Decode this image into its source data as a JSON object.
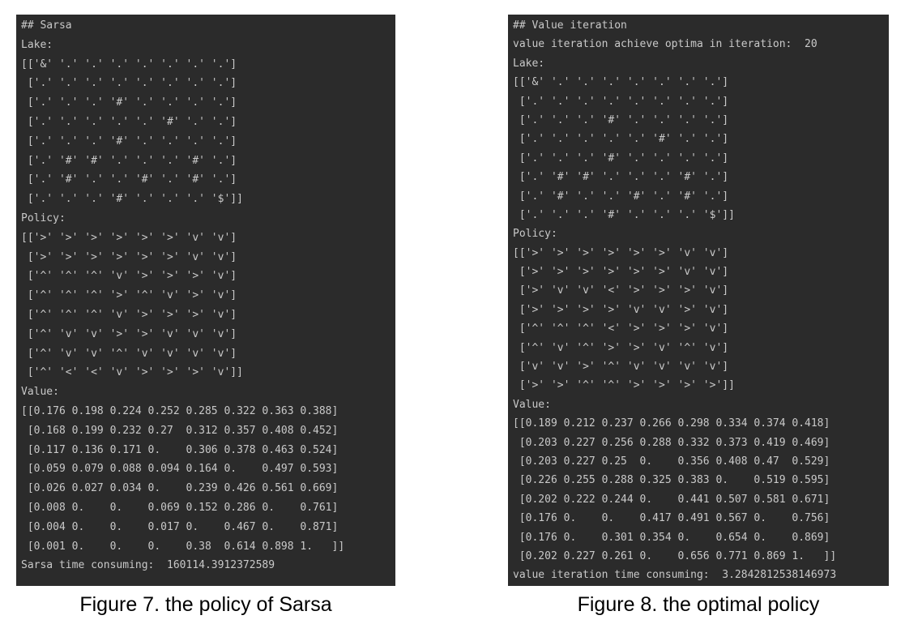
{
  "left": {
    "lines": [
      "## Sarsa",
      "Lake:",
      "[['&' '.' '.' '.' '.' '.' '.' '.']",
      " ['.' '.' '.' '.' '.' '.' '.' '.']",
      " ['.' '.' '.' '#' '.' '.' '.' '.']",
      " ['.' '.' '.' '.' '.' '#' '.' '.']",
      " ['.' '.' '.' '#' '.' '.' '.' '.']",
      " ['.' '#' '#' '.' '.' '.' '#' '.']",
      " ['.' '#' '.' '.' '#' '.' '#' '.']",
      " ['.' '.' '.' '#' '.' '.' '.' '$']]",
      "Policy:",
      "[['>' '>' '>' '>' '>' '>' 'v' 'v']",
      " ['>' '>' '>' '>' '>' '>' 'v' 'v']",
      " ['^' '^' '^' 'v' '>' '>' '>' 'v']",
      " ['^' '^' '^' '>' '^' 'v' '>' 'v']",
      " ['^' '^' '^' 'v' '>' '>' '>' 'v']",
      " ['^' 'v' 'v' '>' '>' 'v' 'v' 'v']",
      " ['^' 'v' 'v' '^' 'v' 'v' 'v' 'v']",
      " ['^' '<' '<' 'v' '>' '>' '>' 'v']]",
      "Value:",
      "[[0.176 0.198 0.224 0.252 0.285 0.322 0.363 0.388]",
      " [0.168 0.199 0.232 0.27  0.312 0.357 0.408 0.452]",
      " [0.117 0.136 0.171 0.    0.306 0.378 0.463 0.524]",
      " [0.059 0.079 0.088 0.094 0.164 0.    0.497 0.593]",
      " [0.026 0.027 0.034 0.    0.239 0.426 0.561 0.669]",
      " [0.008 0.    0.    0.069 0.152 0.286 0.    0.761]",
      " [0.004 0.    0.    0.017 0.    0.467 0.    0.871]",
      " [0.001 0.    0.    0.    0.38  0.614 0.898 1.   ]]",
      "Sarsa time consuming:  160114.3912372589"
    ],
    "caption": "Figure 7. the policy of Sarsa"
  },
  "right": {
    "lines": [
      "## Value iteration",
      "value iteration achieve optima in iteration:  20",
      "Lake:",
      "[['&' '.' '.' '.' '.' '.' '.' '.']",
      " ['.' '.' '.' '.' '.' '.' '.' '.']",
      " ['.' '.' '.' '#' '.' '.' '.' '.']",
      " ['.' '.' '.' '.' '.' '#' '.' '.']",
      " ['.' '.' '.' '#' '.' '.' '.' '.']",
      " ['.' '#' '#' '.' '.' '.' '#' '.']",
      " ['.' '#' '.' '.' '#' '.' '#' '.']",
      " ['.' '.' '.' '#' '.' '.' '.' '$']]",
      "Policy:",
      "[['>' '>' '>' '>' '>' '>' 'v' 'v']",
      " ['>' '>' '>' '>' '>' '>' 'v' 'v']",
      " ['>' 'v' 'v' '<' '>' '>' '>' 'v']",
      " ['>' '>' '>' '>' 'v' 'v' '>' 'v']",
      " ['^' '^' '^' '<' '>' '>' '>' 'v']",
      " ['^' 'v' '^' '>' '>' 'v' '^' 'v']",
      " ['v' 'v' '>' '^' 'v' 'v' 'v' 'v']",
      " ['>' '>' '^' '^' '>' '>' '>' '>']]",
      "Value:",
      "[[0.189 0.212 0.237 0.266 0.298 0.334 0.374 0.418]",
      " [0.203 0.227 0.256 0.288 0.332 0.373 0.419 0.469]",
      " [0.203 0.227 0.25  0.    0.356 0.408 0.47  0.529]",
      " [0.226 0.255 0.288 0.325 0.383 0.    0.519 0.595]",
      " [0.202 0.222 0.244 0.    0.441 0.507 0.581 0.671]",
      " [0.176 0.    0.    0.417 0.491 0.567 0.    0.756]",
      " [0.176 0.    0.301 0.354 0.    0.654 0.    0.869]",
      " [0.202 0.227 0.261 0.    0.656 0.771 0.869 1.   ]]",
      "value iteration time consuming:  3.2842812538146973"
    ],
    "caption": "Figure 8. the optimal policy"
  }
}
